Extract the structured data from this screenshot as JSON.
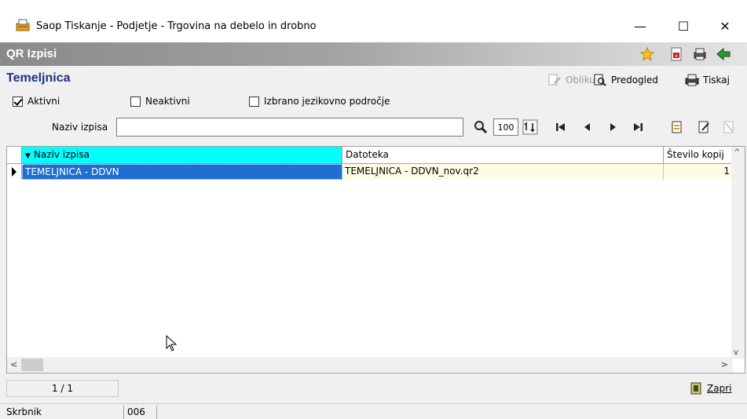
{
  "window": {
    "title": "Saop Tiskanje - Podjetje - Trgovina na debelo in drobno",
    "minimize": "—",
    "maximize": "☐",
    "close": "✕"
  },
  "header": {
    "title": "QR Izpisi"
  },
  "panel": {
    "title": "Temeljnica",
    "toolbar": {
      "edit_label": "Oblikuj",
      "preview_label": "Predogled",
      "print_label": "Tiskaj"
    }
  },
  "filters": {
    "active_label": "Aktivni",
    "active_checked": true,
    "inactive_label": "Neaktivni",
    "inactive_checked": false,
    "language_label": "Izbrano jezikovno področje",
    "language_checked": false
  },
  "search": {
    "label": "Naziv izpisa",
    "value": "",
    "zoom_value": "100"
  },
  "table": {
    "columns": [
      "Naziv izpisa",
      "Datoteka",
      "Število kopij"
    ],
    "rows": [
      {
        "name": "TEMELJNICA - DDVN",
        "file": "TEMELJNICA - DDVN_nov.qr2",
        "copies": "1"
      }
    ]
  },
  "pager": {
    "text": "1 / 1"
  },
  "footer": {
    "close_label": "Zapri"
  },
  "status": {
    "user_label": "Skrbnik",
    "code": "006"
  },
  "colors": {
    "accent": "#1f2f8c",
    "sorted_header": "#00ffff",
    "selection": "#1e6fd0"
  }
}
